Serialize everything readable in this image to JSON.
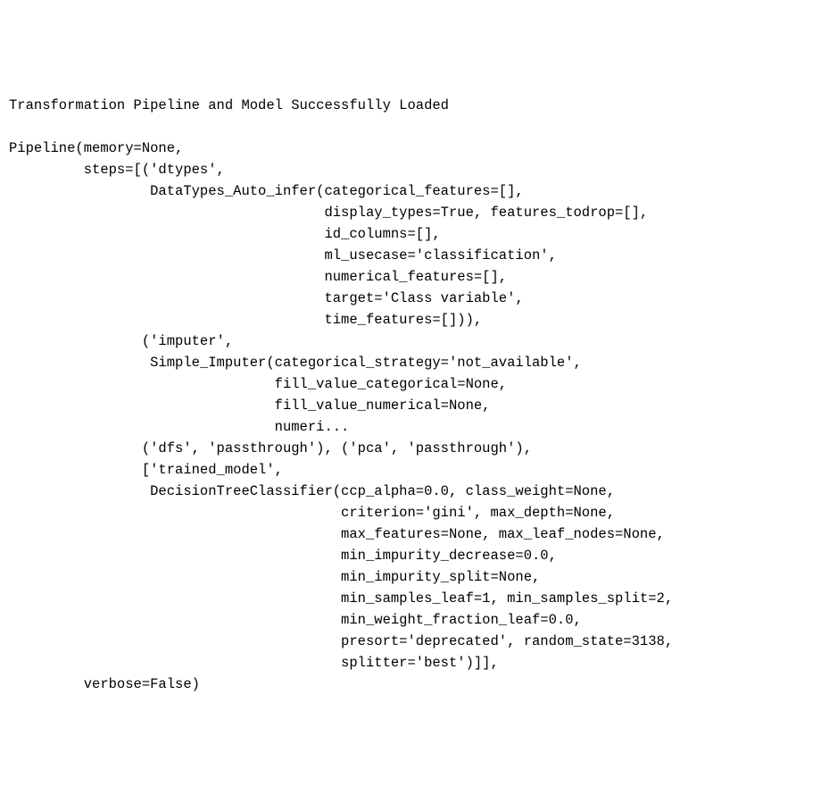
{
  "header_line": "Transformation Pipeline and Model Successfully Loaded",
  "blank_line": "",
  "lines": [
    "Pipeline(memory=None,",
    "         steps=[('dtypes',",
    "                 DataTypes_Auto_infer(categorical_features=[],",
    "                                      display_types=True, features_todrop=[],",
    "                                      id_columns=[],",
    "                                      ml_usecase='classification',",
    "                                      numerical_features=[],",
    "                                      target='Class variable',",
    "                                      time_features=[])),",
    "                ('imputer',",
    "                 Simple_Imputer(categorical_strategy='not_available',",
    "                                fill_value_categorical=None,",
    "                                fill_value_numerical=None,",
    "                                numeri...",
    "                ('dfs', 'passthrough'), ('pca', 'passthrough'),",
    "                ['trained_model',",
    "                 DecisionTreeClassifier(ccp_alpha=0.0, class_weight=None,",
    "                                        criterion='gini', max_depth=None,",
    "                                        max_features=None, max_leaf_nodes=None,",
    "                                        min_impurity_decrease=0.0,",
    "                                        min_impurity_split=None,",
    "                                        min_samples_leaf=1, min_samples_split=2,",
    "                                        min_weight_fraction_leaf=0.0,",
    "                                        presort='deprecated', random_state=3138,",
    "                                        splitter='best')]],",
    "         verbose=False)"
  ]
}
